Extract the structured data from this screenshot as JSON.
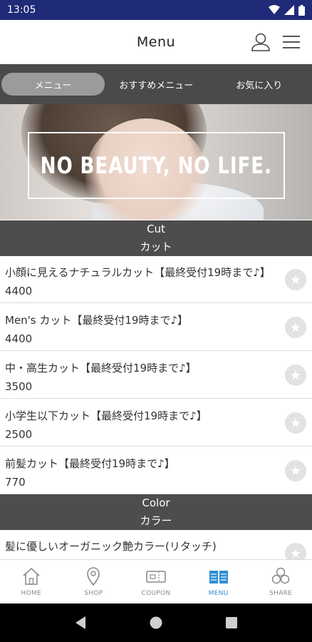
{
  "status_bar": {
    "time": "13:05"
  },
  "header": {
    "title": "Menu"
  },
  "tabs": [
    {
      "label": "メニュー",
      "active": true
    },
    {
      "label": "おすすめメニュー",
      "active": false
    },
    {
      "label": "お気に入り",
      "active": false
    }
  ],
  "hero": {
    "text": "NO BEAUTY, NO LIFE."
  },
  "sections": [
    {
      "title_en": "Cut",
      "title_ja": "カット",
      "items": [
        {
          "name": "小顔に見えるナチュラルカット【最終受付19時まで♪】",
          "price": "4400"
        },
        {
          "name": "Men's カット【最終受付19時まで♪】",
          "price": "4400"
        },
        {
          "name": "中・高生カット【最終受付19時まで♪】",
          "price": "3500"
        },
        {
          "name": "小学生以下カット【最終受付19時まで♪】",
          "price": "2500"
        },
        {
          "name": "前髪カット【最終受付19時まで♪】",
          "price": "770"
        }
      ]
    },
    {
      "title_en": "Color",
      "title_ja": "カラー",
      "items": [
        {
          "name": "髪に優しいオーガニック艶カラー(リタッチ)",
          "price": ""
        }
      ]
    }
  ],
  "bottom_nav": [
    {
      "label": "HOME",
      "icon": "home-icon",
      "active": false
    },
    {
      "label": "SHOP",
      "icon": "map-pin-icon",
      "active": false
    },
    {
      "label": "COUPON",
      "icon": "coupon-icon",
      "active": false
    },
    {
      "label": "MENU",
      "icon": "book-icon",
      "active": true
    },
    {
      "label": "SHARE",
      "icon": "share-icon",
      "active": false
    }
  ],
  "colors": {
    "status_bar": "#1f2a78",
    "tabbar": "#4a4a4a",
    "section_header": "#4d4d4d",
    "active_nav": "#2d8fd6"
  }
}
